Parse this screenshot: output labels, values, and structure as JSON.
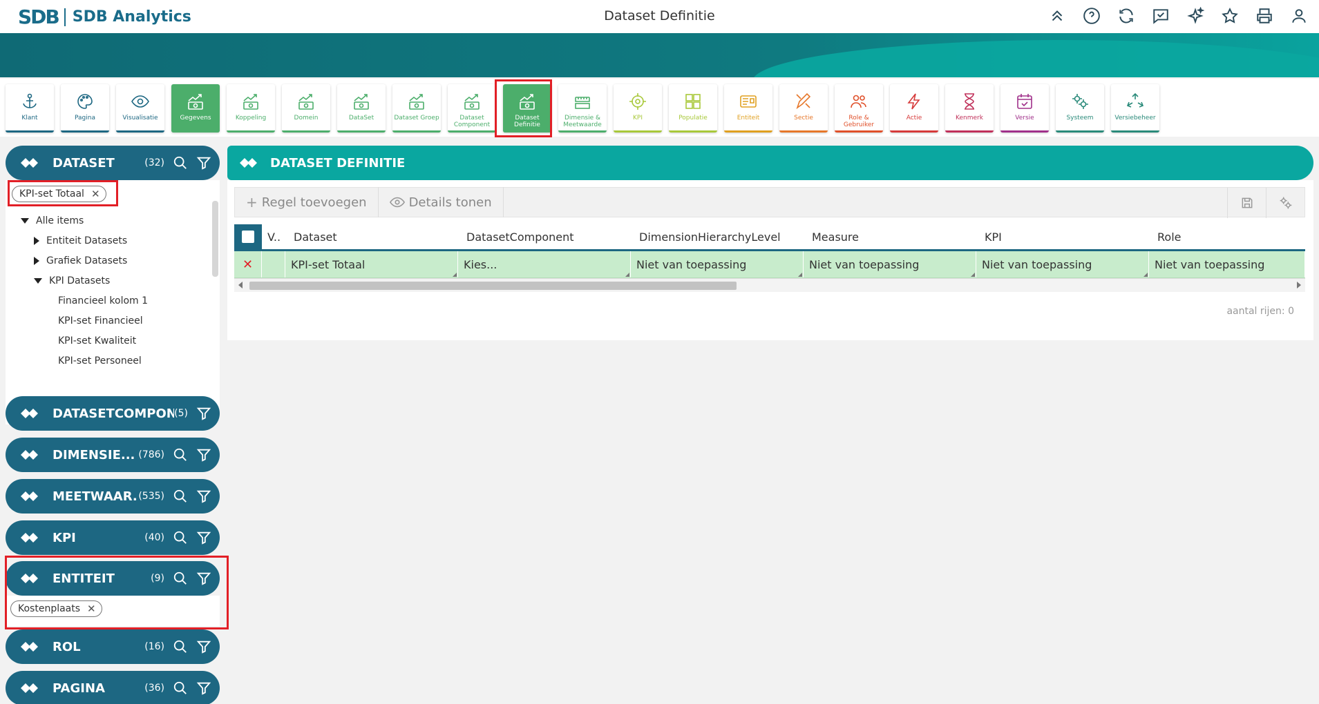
{
  "header": {
    "brand_mark": "SDB",
    "brand_name": "SDB Analytics",
    "page_title": "Dataset Definitie",
    "icons": [
      "chevrons-up-icon",
      "help-icon",
      "refresh-icon",
      "message-check-icon",
      "sparkles-icon",
      "star-icon",
      "print-icon",
      "user-icon"
    ]
  },
  "modules": [
    {
      "label": "Klant",
      "icon": "anchor-icon",
      "color": "#1d6782"
    },
    {
      "label": "Pagina",
      "icon": "palette-icon",
      "color": "#1d6782"
    },
    {
      "label": "Visualisatie",
      "icon": "eye-icon",
      "color": "#1d6782"
    },
    {
      "label": "Gegevens",
      "icon": "chart-money-icon",
      "color": "#4cae6b",
      "active": true
    },
    {
      "label": "Koppeling",
      "icon": "chart-money-icon",
      "color": "#4cae6b"
    },
    {
      "label": "Domein",
      "icon": "chart-money-icon",
      "color": "#4cae6b"
    },
    {
      "label": "DataSet",
      "icon": "chart-money-icon",
      "color": "#4cae6b"
    },
    {
      "label": "Dataset Groep",
      "icon": "chart-money-icon",
      "color": "#4cae6b"
    },
    {
      "label": "Dataset Component",
      "icon": "chart-money-icon",
      "color": "#4cae6b"
    },
    {
      "label": "Dataset Definitie",
      "icon": "chart-money-icon",
      "color": "#4cae6b",
      "selected": true
    },
    {
      "label": "Dimensie & Meetwaarde",
      "icon": "ruler-icon",
      "color": "#4cae6b"
    },
    {
      "label": "KPI",
      "icon": "crosshair-icon",
      "color": "#a8c83a"
    },
    {
      "label": "Populatie",
      "icon": "puzzle-icon",
      "color": "#a8c83a"
    },
    {
      "label": "Entiteit",
      "icon": "id-card-icon",
      "color": "#e0a020"
    },
    {
      "label": "Sectie",
      "icon": "pencil-ruler-icon",
      "color": "#e6772a"
    },
    {
      "label": "Role & Gebruiker",
      "icon": "users-icon",
      "color": "#e0502a"
    },
    {
      "label": "Actie",
      "icon": "lightning-icon",
      "color": "#d63a3a"
    },
    {
      "label": "Kenmerk",
      "icon": "hourglass-icon",
      "color": "#c0305a"
    },
    {
      "label": "Versie",
      "icon": "calendar-check-icon",
      "color": "#a0308a"
    },
    {
      "label": "Systeem",
      "icon": "gears-icon",
      "color": "#2a8a7a"
    },
    {
      "label": "Versiebeheer",
      "icon": "recycle-icon",
      "color": "#2a8a7a"
    }
  ],
  "sidebar": {
    "dataset": {
      "title": "DATASET",
      "count": "(32)",
      "chip": "KPI-set Totaal",
      "tree": [
        {
          "label": "Alle items",
          "level": 0,
          "toggle": "down"
        },
        {
          "label": "Entiteit Datasets",
          "level": 1,
          "toggle": "right"
        },
        {
          "label": "Grafiek Datasets",
          "level": 1,
          "toggle": "right"
        },
        {
          "label": "KPI Datasets",
          "level": 1,
          "toggle": "down"
        },
        {
          "label": "Financieel kolom 1",
          "level": 2,
          "toggle": ""
        },
        {
          "label": "KPI-set Financieel",
          "level": 2,
          "toggle": ""
        },
        {
          "label": "KPI-set Kwaliteit",
          "level": 2,
          "toggle": ""
        },
        {
          "label": "KPI-set Personeel",
          "level": 2,
          "toggle": ""
        }
      ]
    },
    "panels": [
      {
        "title": "DATASETCOMPON...",
        "count": "(5)",
        "search": false
      },
      {
        "title": "DIMENSIE...",
        "count": "(786)",
        "search": true
      },
      {
        "title": "MEETWAAR...",
        "count": "(535)",
        "search": true
      },
      {
        "title": "KPI",
        "count": "(40)",
        "search": true
      }
    ],
    "entiteit": {
      "title": "ENTITEIT",
      "count": "(9)",
      "chip": "Kostenplaats"
    },
    "bottom_panels": [
      {
        "title": "ROL",
        "count": "(16)"
      },
      {
        "title": "PAGINA",
        "count": "(36)"
      }
    ]
  },
  "main": {
    "title": "DATASET DEFINITIE",
    "toolbar": {
      "add_label": "Regel toevoegen",
      "details_label": "Details tonen"
    },
    "grid": {
      "columns": [
        "V..",
        "Dataset",
        "DatasetComponent",
        "DimensionHierarchyLevel",
        "Measure",
        "KPI",
        "Role"
      ],
      "row": [
        "KPI-set Totaal",
        "Kies...",
        "Niet van toepassing",
        "Niet van toepassing",
        "Niet van toepassing",
        "Niet van toepassing"
      ]
    },
    "row_count": "aantal rijen: 0"
  },
  "colors": {
    "header_blue": "#1d6782",
    "teal": "#0aa7a0",
    "green": "#4cae6b",
    "row_green": "#c8eccc",
    "highlight_red": "#e21f26"
  }
}
